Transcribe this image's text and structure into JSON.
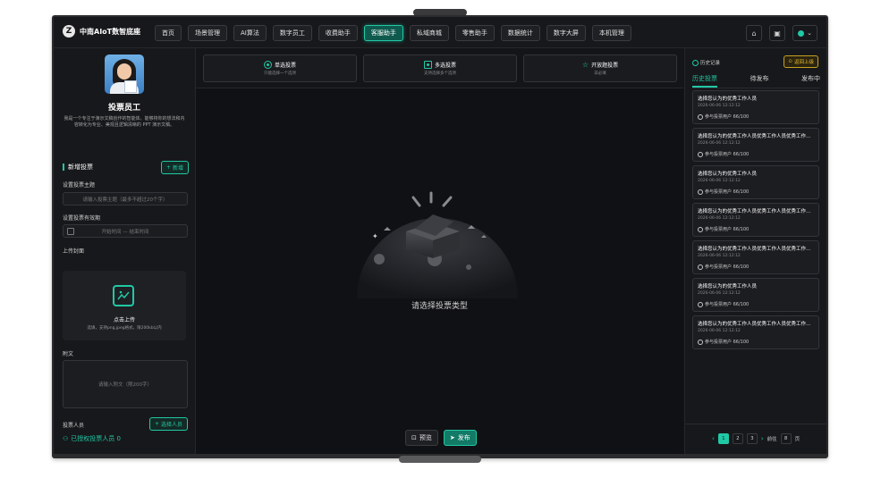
{
  "header": {
    "app_title": "中南AIoT数智底座",
    "logo_glyph": "Z",
    "nav": [
      "首页",
      "场景管理",
      "AI算法",
      "数字员工",
      "收费助手",
      "客服助手",
      "私域商城",
      "零售助手",
      "数据统计",
      "数字大屏",
      "本机管理"
    ],
    "active_nav": "客服助手"
  },
  "employee": {
    "name": "投票员工",
    "description": "我是一个专注于演示文稿创作的智能体。能够将你的想法和内容转化为专业、美观且逻辑清晰的 PPT 演示文稿。"
  },
  "form": {
    "section_title": "新增投票",
    "add_label": "新增",
    "topic_label": "设置投票主题",
    "topic_placeholder": "请输入投票主题（最多不超过20个字）",
    "validity_label": "设置投票有效期",
    "validity_placeholder": "开始时间 — 结束时间",
    "cover_label": "上传封面",
    "upload_title": "点击上传",
    "upload_hint": "选填，支持png,jpeg格式，限200kb以内",
    "attachment_label": "附文",
    "attachment_placeholder": "请输入附文（限200字）",
    "voters_label": "投票人员",
    "select_voters": "选择人员",
    "authorized": "已授权投票人员 0"
  },
  "vote_types": [
    {
      "title": "单选投票",
      "subtitle": "只能选择一个选项"
    },
    {
      "title": "多选投票",
      "subtitle": "支持选择多个选项"
    },
    {
      "title": "开放题投票",
      "subtitle": "非必填"
    }
  ],
  "center": {
    "empty_text": "请选择投票类型",
    "preview": "预览",
    "publish": "发布"
  },
  "history": {
    "label": "历史记录",
    "back": "返回上级",
    "tabs": [
      "历史投票",
      "待发布",
      "发布中"
    ],
    "items": [
      {
        "title": "选择您认为的优秀工作人员",
        "date": "2026-06-06 12:12:12",
        "participants": "参与投票用户 66/100"
      },
      {
        "title": "选择您认为的优秀工作人员优秀工作人员优秀工作人员",
        "date": "2026-06-06 12:12:12",
        "participants": "参与投票用户 66/100"
      },
      {
        "title": "选择您认为的优秀工作人员",
        "date": "2026-06-06 12:12:12",
        "participants": "参与投票用户 66/100"
      },
      {
        "title": "选择您认为的优秀工作人员优秀工作人员优秀工作人员",
        "date": "2026-06-06 12:12:12",
        "participants": "参与投票用户 66/100"
      },
      {
        "title": "选择您认为的优秀工作人员优秀工作人员优秀工作人员",
        "date": "2026-06-06 12:12:12",
        "participants": "参与投票用户 66/100"
      },
      {
        "title": "选择您认为的优秀工作人员",
        "date": "2026-06-06 12:12:12",
        "participants": "参与投票用户 66/100"
      },
      {
        "title": "选择您认为的优秀工作人员优秀工作人员优秀工作人员",
        "date": "2026-06-06 12:12:12",
        "participants": "参与投票用户 66/100"
      }
    ]
  },
  "pager": {
    "pages": [
      "1",
      "2",
      "3"
    ],
    "goto_prefix": "前往",
    "goto_value": "8",
    "goto_suffix": "页"
  },
  "colors": {
    "accent": "#20c9a5",
    "warning": "#e6b92e",
    "background": "#121316"
  }
}
